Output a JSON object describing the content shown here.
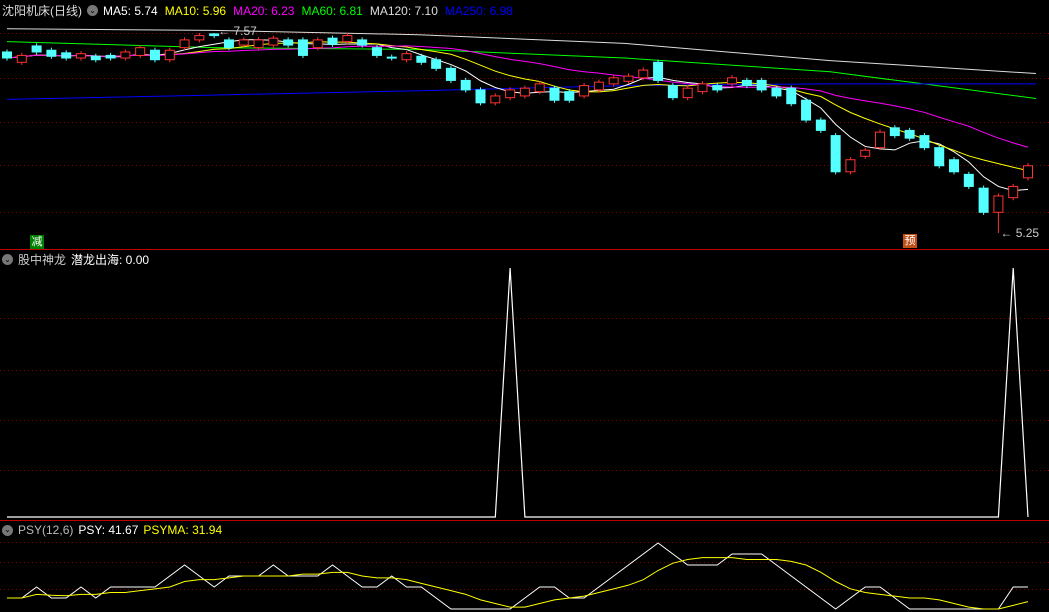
{
  "header": {
    "title": "沈阳机床(日线)",
    "ma": [
      {
        "label": "MA5: 5.74",
        "color": "#ffffff"
      },
      {
        "label": "MA10: 5.96",
        "color": "#ffff00"
      },
      {
        "label": "MA20: 6.23",
        "color": "#ff00ff"
      },
      {
        "label": "MA60: 6.81",
        "color": "#00ff00"
      },
      {
        "label": "MA120: 7.10",
        "color": "#dddddd"
      },
      {
        "label": "MA250: 6.98",
        "color": "#0000ff"
      }
    ]
  },
  "price_chart": {
    "high_label": "7.57",
    "low_label": "5.25",
    "tag_left": "减",
    "tag_right": "预",
    "colors": {
      "up": "#ff3232",
      "down": "#54ffff"
    },
    "candles": [
      [
        7.35,
        7.28
      ],
      [
        7.23,
        7.31
      ],
      [
        7.42,
        7.35
      ],
      [
        7.37,
        7.3
      ],
      [
        7.34,
        7.28
      ],
      [
        7.28,
        7.33
      ],
      [
        7.3,
        7.26
      ],
      [
        7.31,
        7.28
      ],
      [
        7.28,
        7.35
      ],
      [
        7.31,
        7.4
      ],
      [
        7.37,
        7.26
      ],
      [
        7.26,
        7.37
      ],
      [
        7.4,
        7.49
      ],
      [
        7.49,
        7.54
      ],
      [
        7.56,
        7.54
      ],
      [
        7.49,
        7.4
      ],
      [
        7.43,
        7.49
      ],
      [
        7.4,
        7.49
      ],
      [
        7.43,
        7.51
      ],
      [
        7.49,
        7.43
      ],
      [
        7.49,
        7.31
      ],
      [
        7.4,
        7.49
      ],
      [
        7.51,
        7.44
      ],
      [
        7.47,
        7.54
      ],
      [
        7.49,
        7.43
      ],
      [
        7.4,
        7.31
      ],
      [
        7.29,
        7.28
      ],
      [
        7.26,
        7.33
      ],
      [
        7.3,
        7.23
      ],
      [
        7.26,
        7.16
      ],
      [
        7.16,
        7.02
      ],
      [
        7.02,
        6.91
      ],
      [
        6.91,
        6.76
      ],
      [
        6.76,
        6.84
      ],
      [
        6.82,
        6.91
      ],
      [
        6.84,
        6.93
      ],
      [
        6.89,
        6.98
      ],
      [
        6.93,
        6.79
      ],
      [
        6.89,
        6.79
      ],
      [
        6.84,
        6.96
      ],
      [
        6.91,
        7.0
      ],
      [
        6.98,
        7.05
      ],
      [
        7.01,
        7.07
      ],
      [
        7.05,
        7.14
      ],
      [
        7.23,
        7.02
      ],
      [
        6.96,
        6.82
      ],
      [
        6.82,
        6.93
      ],
      [
        6.89,
        6.98
      ],
      [
        6.96,
        6.91
      ],
      [
        6.98,
        7.05
      ],
      [
        7.02,
        6.96
      ],
      [
        7.02,
        6.91
      ],
      [
        6.93,
        6.84
      ],
      [
        6.93,
        6.75
      ],
      [
        6.79,
        6.56
      ],
      [
        6.56,
        6.44
      ],
      [
        6.38,
        5.96
      ],
      [
        5.96,
        6.1
      ],
      [
        6.14,
        6.21
      ],
      [
        6.24,
        6.42
      ],
      [
        6.47,
        6.38
      ],
      [
        6.44,
        6.35
      ],
      [
        6.38,
        6.24
      ],
      [
        6.24,
        6.03
      ],
      [
        6.1,
        5.96
      ],
      [
        5.93,
        5.79
      ],
      [
        5.77,
        5.49
      ],
      [
        5.49,
        5.68
      ],
      [
        5.66,
        5.79
      ],
      [
        5.89,
        6.03
      ]
    ],
    "high_index": 14,
    "low_index": 67,
    "long_ma": [
      {
        "name": "MA120",
        "color": "#dddddd",
        "values": [
          7.62,
          7.6,
          7.55,
          7.45,
          7.25,
          7.1
        ]
      },
      {
        "name": "MA60",
        "color": "#00ff00",
        "values": [
          7.47,
          7.4,
          7.38,
          7.28,
          7.12,
          6.81
        ]
      },
      {
        "name": "MA250",
        "color": "#0000ff",
        "values": [
          6.8,
          6.85,
          6.9,
          6.96,
          6.98,
          6.98
        ]
      }
    ]
  },
  "indicator": {
    "name": "股中神龙",
    "value_label": "潜龙出海: 0.00",
    "signal_indices": [
      34,
      68
    ]
  },
  "psy": {
    "name": "PSY(12,6)",
    "psy_label": "PSY: 41.67",
    "psyma_label": "PSYMA: 31.94",
    "values": [
      33.33,
      33.33,
      41.67,
      33.33,
      33.33,
      41.67,
      33.33,
      41.67,
      41.67,
      41.67,
      41.67,
      50,
      58.33,
      50,
      41.67,
      50,
      50,
      50,
      58.33,
      50,
      50,
      50,
      58.33,
      50,
      41.67,
      41.67,
      50,
      41.67,
      41.67,
      33.33,
      25,
      25,
      25,
      25,
      25,
      33.33,
      41.67,
      41.67,
      33.33,
      33.33,
      41.67,
      50,
      58.33,
      66.67,
      75,
      66.67,
      58.33,
      58.33,
      58.33,
      66.67,
      66.67,
      66.67,
      58.33,
      50,
      41.67,
      33.33,
      25,
      33.33,
      41.67,
      41.67,
      33.33,
      25,
      25,
      25,
      25,
      25,
      25,
      25,
      41.67,
      41.67
    ]
  }
}
